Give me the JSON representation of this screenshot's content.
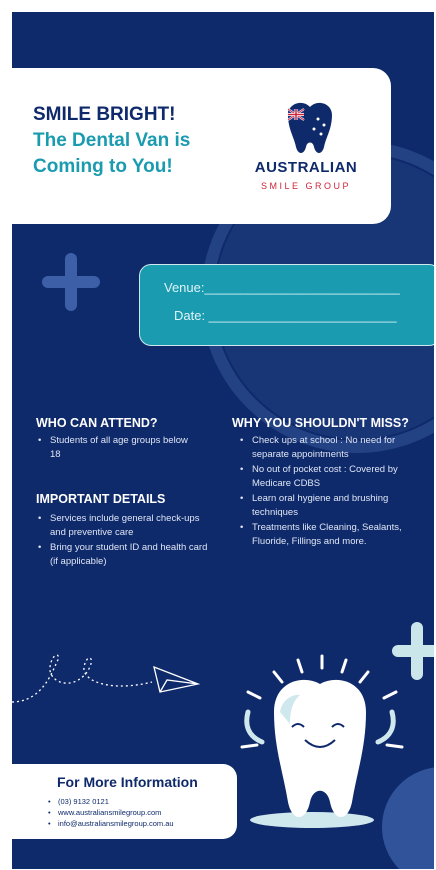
{
  "colors": {
    "navy": "#0f2a6b",
    "teal": "#1a9bb0",
    "white": "#ffffff",
    "red": "#d0243a"
  },
  "header": {
    "line1": "SMILE BRIGHT!",
    "line2": "The Dental Van is",
    "line3": "Coming to You!"
  },
  "logo": {
    "name": "AUSTRALIAN",
    "tagline": "SMILE GROUP",
    "icon": "tooth-flag-logo"
  },
  "venue": {
    "venue_label": "Venue:___________________________",
    "date_label": "Date: __________________________"
  },
  "who": {
    "title": "WHO CAN ATTEND?",
    "items": [
      "Students of all age groups below 18"
    ]
  },
  "important": {
    "title": "IMPORTANT DETAILS",
    "items": [
      "Services include general check-ups and preventive care",
      "Bring your student ID and health card (if applicable)"
    ]
  },
  "why": {
    "title": "WHY YOU SHOULDN'T MISS?",
    "items": [
      "Check ups at school : No need for separate appointments",
      "No out of pocket cost : Covered by Medicare CDBS",
      "Learn oral hygiene and brushing techniques",
      "Treatments like Cleaning, Sealants, Fluoride, Fillings and more."
    ]
  },
  "contact": {
    "title": "For More Information",
    "items": [
      "(03) 9132 0121",
      "www.australiansmilegroup.com",
      "info@australiansmilegroup.com.au"
    ]
  },
  "icons": [
    "plus-icon",
    "paper-plane-icon",
    "smiling-tooth-icon"
  ]
}
